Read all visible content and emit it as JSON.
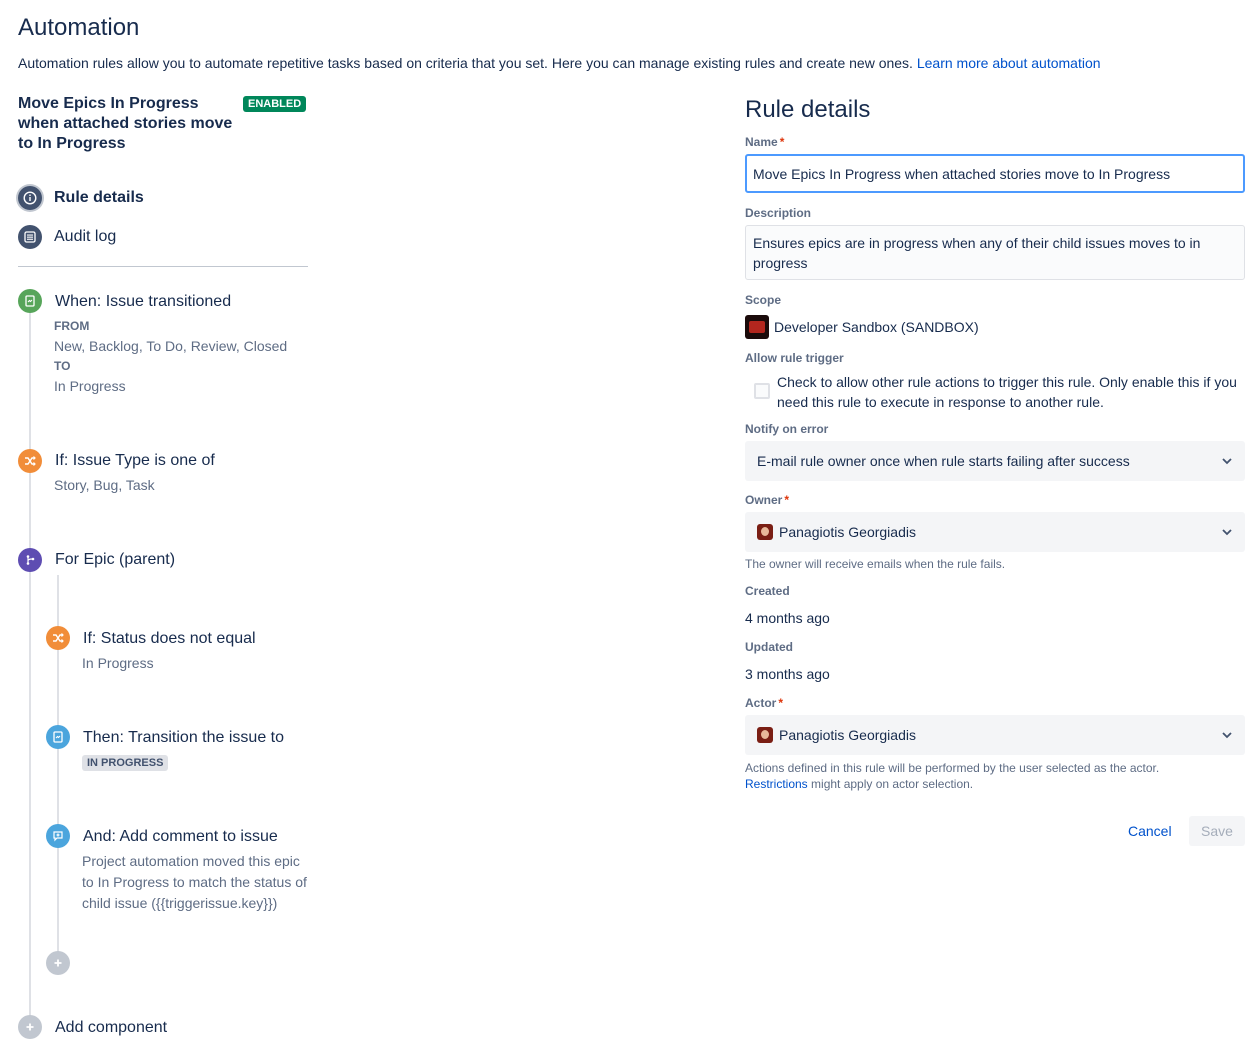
{
  "page": {
    "title": "Automation",
    "intro_text": "Automation rules allow you to automate repetitive tasks based on criteria that you set. Here you can manage existing rules and create new ones.",
    "intro_link": "Learn more about automation"
  },
  "rule": {
    "name": "Move Epics In Progress when attached stories move to In Progress",
    "status_badge": "ENABLED"
  },
  "nav": {
    "rule_details": "Rule details",
    "audit_log": "Audit log"
  },
  "components": {
    "trigger": {
      "title": "When: Issue transitioned",
      "from_label": "FROM",
      "from_value": "New, Backlog, To Do, Review, Closed",
      "to_label": "TO",
      "to_value": "In Progress"
    },
    "condition1": {
      "title": "If: Issue Type is one of",
      "value": "Story, Bug, Task"
    },
    "branch": {
      "title": "For Epic (parent)"
    },
    "condition2": {
      "title": "If: Status does not equal",
      "value": "In Progress"
    },
    "action1": {
      "title": "Then: Transition the issue to",
      "status": "IN PROGRESS"
    },
    "action2": {
      "title": "And: Add comment to issue",
      "line1": "Project automation moved this epic",
      "line2": "to In Progress to match the status of",
      "line3": "child issue ({{triggerissue.key}})"
    },
    "add_component": "Add component"
  },
  "details": {
    "title": "Rule details",
    "name_label": "Name",
    "name_value": "Move Epics In Progress when attached stories move to In Progress",
    "description_label": "Description",
    "description_value": "Ensures epics are in progress when any of their child issues moves to in progress",
    "scope_label": "Scope",
    "scope_value": "Developer Sandbox (SANDBOX)",
    "allow_trigger_label": "Allow rule trigger",
    "allow_trigger_line1": "Check to allow other rule actions to trigger this rule. Only enable this if you",
    "allow_trigger_line2": "need this rule to execute in response to another rule.",
    "allow_trigger_checked": false,
    "notify_label": "Notify on error",
    "notify_value": "E-mail rule owner once when rule starts failing after success",
    "owner_label": "Owner",
    "owner_value": "Panagiotis Georgiadis",
    "owner_help": "The owner will receive emails when the rule fails.",
    "created_label": "Created",
    "created_value": "4 months ago",
    "updated_label": "Updated",
    "updated_value": "3 months ago",
    "actor_label": "Actor",
    "actor_value": "Panagiotis Georgiadis",
    "actor_help": "Actions defined in this rule will be performed by the user selected as the actor.",
    "actor_help_link": "Restrictions",
    "actor_help_tail": "might apply on actor selection.",
    "required_marker": "*",
    "cancel": "Cancel",
    "save": "Save"
  }
}
